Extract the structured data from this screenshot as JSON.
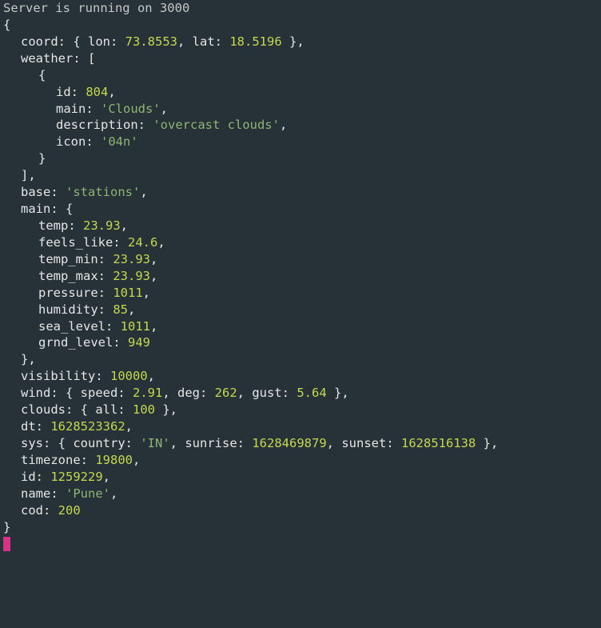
{
  "header": "Server is running on 3000",
  "obj": {
    "coord": {
      "lon": "73.8553",
      "lat": "18.5196"
    },
    "weather": {
      "id": "804",
      "main": "'Clouds'",
      "description": "'overcast clouds'",
      "icon": "'04n'"
    },
    "base": "'stations'",
    "main": {
      "temp": "23.93",
      "feels_like": "24.6",
      "temp_min": "23.93",
      "temp_max": "23.93",
      "pressure": "1011",
      "humidity": "85",
      "sea_level": "1011",
      "grnd_level": "949"
    },
    "visibility": "10000",
    "wind": {
      "speed": "2.91",
      "deg": "262",
      "gust": "5.64"
    },
    "clouds": {
      "all": "100"
    },
    "dt": "1628523362",
    "sys": {
      "country": "'IN'",
      "sunrise": "1628469879",
      "sunset": "1628516138"
    },
    "timezone": "19800",
    "id": "1259229",
    "name": "'Pune'",
    "cod": "200"
  },
  "labels": {
    "coord": "coord",
    "lon": "lon",
    "lat": "lat",
    "weather": "weather",
    "id": "id",
    "main": "main",
    "description": "description",
    "icon": "icon",
    "base": "base",
    "temp": "temp",
    "feels_like": "feels_like",
    "temp_min": "temp_min",
    "temp_max": "temp_max",
    "pressure": "pressure",
    "humidity": "humidity",
    "sea_level": "sea_level",
    "grnd_level": "grnd_level",
    "visibility": "visibility",
    "wind": "wind",
    "speed": "speed",
    "deg": "deg",
    "gust": "gust",
    "clouds": "clouds",
    "all": "all",
    "dt": "dt",
    "sys": "sys",
    "country": "country",
    "sunrise": "sunrise",
    "sunset": "sunset",
    "timezone": "timezone",
    "name": "name",
    "cod": "cod"
  }
}
